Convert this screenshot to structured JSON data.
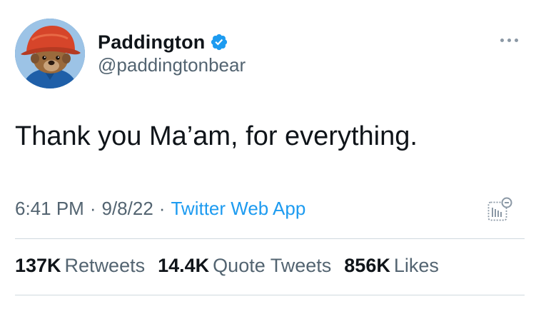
{
  "author": {
    "display_name": "Paddington",
    "handle": "@paddingtonbear",
    "verified": true
  },
  "tweet": {
    "text": "Thank you Ma’am, for everything."
  },
  "meta": {
    "time": "6:41 PM",
    "date": "9/8/22",
    "source": "Twitter Web App",
    "separator": "·"
  },
  "stats": [
    {
      "count": "137K",
      "label": "Retweets"
    },
    {
      "count": "14.4K",
      "label": "Quote Tweets"
    },
    {
      "count": "856K",
      "label": "Likes"
    }
  ],
  "icons": {
    "verified": "verified-badge-icon",
    "more": "more-options-icon",
    "analytics": "analytics-icon"
  },
  "colors": {
    "accent": "#1d9bf0",
    "secondary_text": "#536471",
    "primary_text": "#0f1419",
    "divider": "#cfd9de"
  }
}
